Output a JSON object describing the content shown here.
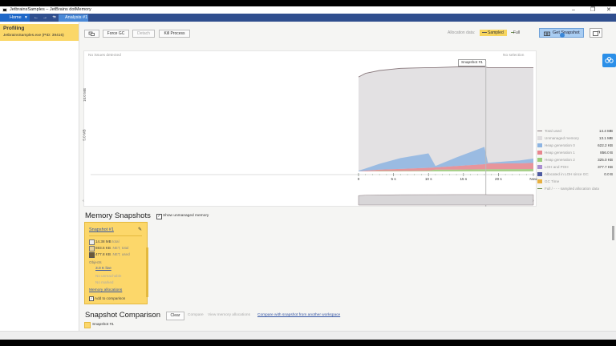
{
  "window": {
    "title": "JetbrainsSamples – JetBrains dotMemory",
    "controls": [
      "–",
      "❐",
      "✕"
    ]
  },
  "tabs": {
    "home": "Home",
    "home_arrow": "▾",
    "analysis": "Analysis #1",
    "analysis_close": "×",
    "nav_back": "←",
    "nav_forward": "→",
    "nav_add": "+"
  },
  "sidebar": {
    "section_title": "Profiling",
    "process": "JetbrainsSamples.exe (PID: 39416)"
  },
  "toolbar": {
    "force_gc": "Force GC",
    "detach": "Detach",
    "kill": "Kill Process",
    "alloc_label": "Allocation data:",
    "sampled": "Sampled",
    "full": "Full",
    "get_snapshot": "Get Snapshot"
  },
  "chart_panel": {
    "no_issues": "No issues detected",
    "no_selection": "No selection",
    "snapshot_marker": "Snapshot #1",
    "y_top": "10.0 MB",
    "y_mid": "5.0 MB"
  },
  "chart_data": {
    "type": "area",
    "xlabel": "",
    "ylabel": "",
    "x_ticks": [
      "0",
      "5 s",
      "10 s",
      "15 s",
      "20 s",
      "Now"
    ],
    "y_ticks": [
      "5.0 MB",
      "10.0 MB"
    ],
    "ylim": [
      0,
      15
    ],
    "x": [
      0,
      1,
      3,
      6,
      10,
      11,
      14,
      18,
      18.5,
      23,
      25
    ],
    "series": [
      {
        "name": "Total used",
        "values": [
          13.1,
          13.6,
          14.0,
          14.3,
          14.4,
          14.4,
          14.5,
          14.5,
          14.4,
          14.4,
          14.4
        ]
      },
      {
        "name": "Heap generation 0",
        "values": [
          0.1,
          0.3,
          0.8,
          1.5,
          2.0,
          0.2,
          1.2,
          2.4,
          0.1,
          0.4,
          0.6
        ]
      },
      {
        "name": "Heap generation 1",
        "values": [
          0.0,
          0.1,
          0.2,
          0.3,
          0.4,
          0.3,
          0.5,
          0.7,
          0.8,
          0.8,
          0.85
        ]
      },
      {
        "name": "Heap generation 2",
        "values": [
          0.0,
          0.0,
          0.05,
          0.05,
          0.1,
          0.25,
          0.25,
          0.3,
          0.3,
          0.32,
          0.33
        ]
      }
    ]
  },
  "legend": [
    {
      "name": "Total used",
      "value": "14.4 MB",
      "color": "#8a7a7e",
      "kind": "line"
    },
    {
      "name": "Unmanaged memory",
      "value": "13.1 MB",
      "color": "#dedcde",
      "kind": "box"
    },
    {
      "name": "Heap generation 0",
      "value": "622.2 KB",
      "color": "#8db4e2",
      "kind": "box"
    },
    {
      "name": "Heap generation 1",
      "value": "856.0 B",
      "color": "#e8868e",
      "kind": "box"
    },
    {
      "name": "Heap generation 2",
      "value": "325.0 KB",
      "color": "#9ccc7a",
      "kind": "box"
    },
    {
      "name": "LOH and POH",
      "value": "377.7 KB",
      "color": "#a98fd0",
      "kind": "box"
    },
    {
      "name": "Allocated in LOH since GC",
      "value": "0.0 B",
      "color": "#4d5aa0",
      "kind": "box"
    },
    {
      "name": "GC Time",
      "value": "",
      "color": "#e8b040",
      "kind": "box"
    },
    {
      "name": "Full / - - - sampled allocation data",
      "value": "",
      "color": "#6a8f4a",
      "kind": "line"
    }
  ],
  "snapshots": {
    "title": "Memory Snapshots",
    "show_unmanaged": "Show unmanaged memory",
    "card": {
      "name": "Snapshot #1",
      "total": "14.38 MB",
      "total_label": "total",
      "net_total": "693.5 KB",
      "net_total_label": ".NET, total",
      "net_used": "477.8 KB",
      "net_used_label": ".NET, used",
      "objects_label": "Objects",
      "alive": "3.0 K live",
      "unreachable": "No unreachable",
      "marked": "No marked",
      "mem_alloc": "Memory allocations",
      "add_compare": "Add to comparison"
    }
  },
  "comparison": {
    "title": "Snapshot Comparison",
    "clear": "Clear",
    "compare": "Compare",
    "view_alloc": "View memory allocations",
    "compare_other": "Compare with snapshot from another workspace",
    "item": "Snapshot #1"
  }
}
